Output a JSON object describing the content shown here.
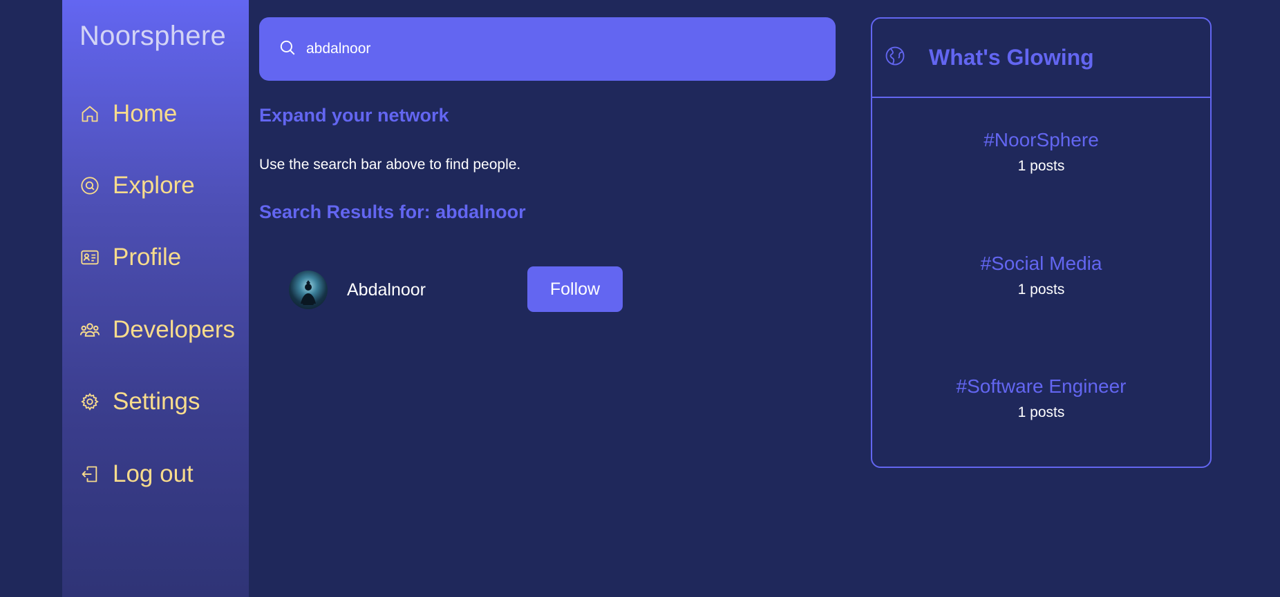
{
  "brand": {
    "name": "Noorsphere"
  },
  "nav": {
    "items": [
      {
        "label": "Home",
        "icon": "home-icon"
      },
      {
        "label": "Explore",
        "icon": "explore-icon"
      },
      {
        "label": "Profile",
        "icon": "profile-card-icon"
      },
      {
        "label": "Developers",
        "icon": "users-icon"
      },
      {
        "label": "Settings",
        "icon": "gear-icon"
      },
      {
        "label": "Log out",
        "icon": "logout-icon"
      }
    ]
  },
  "search": {
    "value": "abdalnoor",
    "icon": "search-icon"
  },
  "main": {
    "expand_heading": "Expand your network",
    "hint": "Use the search bar above to find people.",
    "results_heading": "Search Results for: abdalnoor",
    "results": [
      {
        "name": "Abdalnoor",
        "follow_label": "Follow"
      }
    ]
  },
  "trends": {
    "title": "What's Glowing",
    "icon": "globe-icon",
    "items": [
      {
        "tag": "#NoorSphere",
        "count": "1 posts"
      },
      {
        "tag": "#Social Media",
        "count": "1 posts"
      },
      {
        "tag": "#Software Engineer",
        "count": "1 posts"
      }
    ]
  },
  "colors": {
    "background": "#1f285b",
    "accent": "#6366f1",
    "nav_text": "#f8dc8c",
    "brand_text": "#d3d4f5"
  }
}
